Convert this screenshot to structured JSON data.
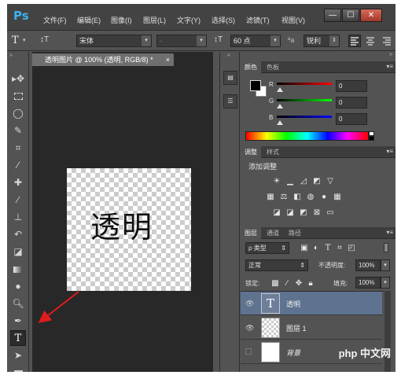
{
  "app": {
    "logo": "Ps"
  },
  "menu": [
    "文件(F)",
    "编辑(E)",
    "图像(I)",
    "图层(L)",
    "文字(Y)",
    "选择(S)",
    "滤镜(T)",
    "视图(V)"
  ],
  "window_controls": {
    "minimize": "—",
    "restore": "☐",
    "close": "✕"
  },
  "options_bar": {
    "tool_glyph": "T",
    "orient_glyph": "↕T",
    "font_family": "宋体",
    "font_style": "-",
    "size_glyph": "↕T",
    "font_size": "60 点",
    "aa_label": "ªa",
    "antialias": "锐利"
  },
  "document": {
    "tab_title": "透明图片 @ 100% (透明, RGB/8) *",
    "tab_close": "×",
    "canvas_text": "透明"
  },
  "color_panel": {
    "tabs": [
      "颜色",
      "色板"
    ],
    "r_label": "R",
    "g_label": "G",
    "b_label": "B",
    "r": "0",
    "g": "0",
    "b": "0"
  },
  "adjust_panel": {
    "tabs": [
      "调整",
      "样式"
    ],
    "title": "添加调整"
  },
  "layers_panel": {
    "tabs": [
      "图层",
      "通道",
      "路径"
    ],
    "filter_kind": "ρ 类型",
    "blend_mode": "正常",
    "opacity_label": "不透明度:",
    "opacity": "100%",
    "lock_label": "锁定:",
    "fill_label": "填充:",
    "fill": "100%",
    "layers": [
      {
        "name": "透明",
        "type": "text"
      },
      {
        "name": "图层 1",
        "type": "pixel"
      },
      {
        "name": "背景",
        "type": "background"
      }
    ]
  },
  "watermark": "php 中文网",
  "colors": {
    "ps_blue": "#3db1f0",
    "selected_layer": "#5e7390",
    "annotation_arrow": "#e01b1b"
  }
}
